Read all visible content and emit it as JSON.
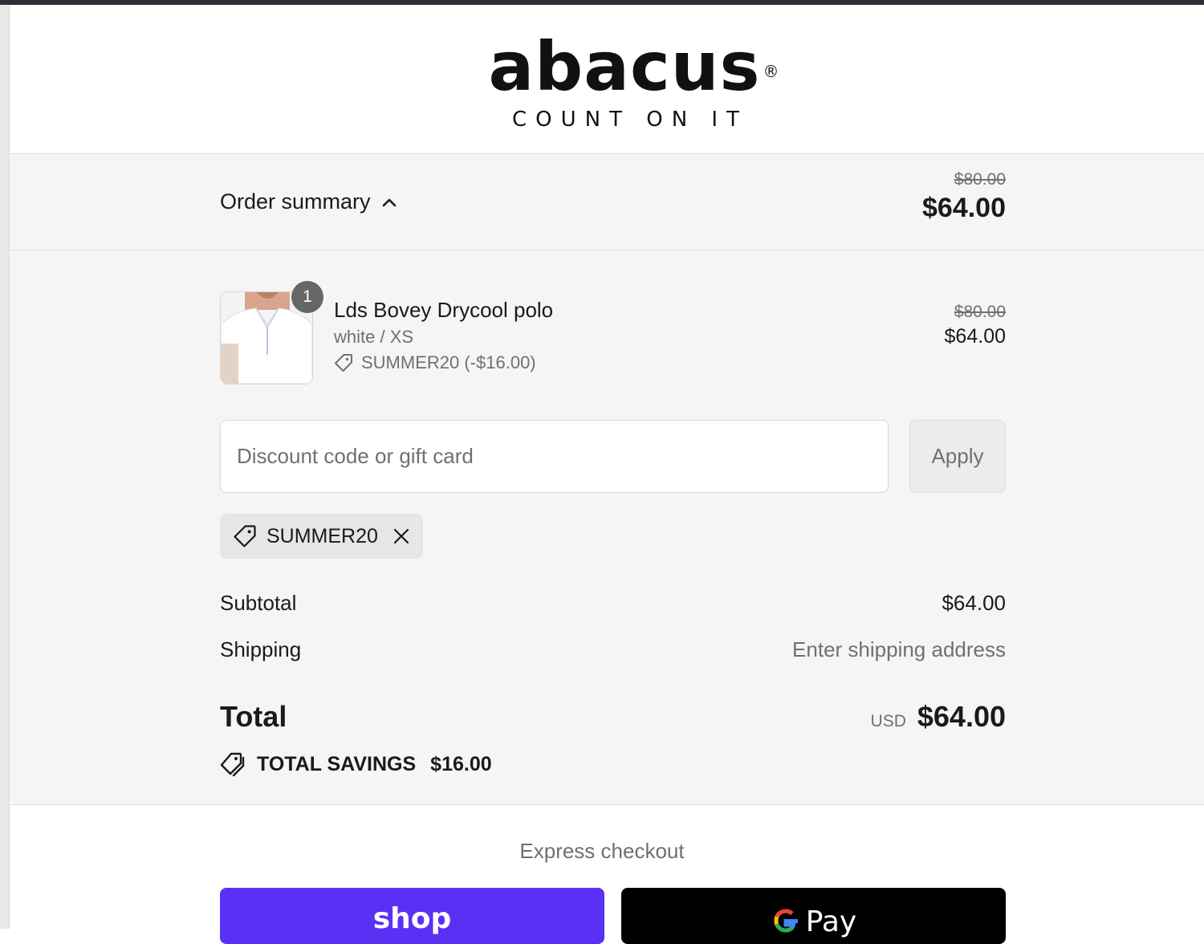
{
  "brand": {
    "name": "abacus",
    "registered_mark": "®",
    "tagline": "COUNT ON IT"
  },
  "order_summary": {
    "toggle_label": "Order summary",
    "original_price": "$80.00",
    "total_price": "$64.00"
  },
  "line_item": {
    "quantity": "1",
    "name": "Lds Bovey Drycool polo",
    "variant": "white / XS",
    "discount_text": "SUMMER20 (-$16.00)",
    "original_price": "$80.00",
    "price": "$64.00"
  },
  "discount": {
    "placeholder": "Discount code or gift card",
    "apply_label": "Apply",
    "applied_code": "SUMMER20"
  },
  "totals": {
    "subtotal_label": "Subtotal",
    "subtotal_value": "$64.00",
    "shipping_label": "Shipping",
    "shipping_value": "Enter shipping address",
    "total_label": "Total",
    "currency": "USD",
    "total_value": "$64.00",
    "savings_label": "TOTAL SAVINGS",
    "savings_value": "$16.00"
  },
  "express_checkout": {
    "label": "Express checkout",
    "shop_label": "shop",
    "gpay_label": "Pay"
  },
  "colors": {
    "shop_pay": "#5a31f4",
    "gpay": "#000000",
    "summary_background": "#f5f5f5"
  }
}
